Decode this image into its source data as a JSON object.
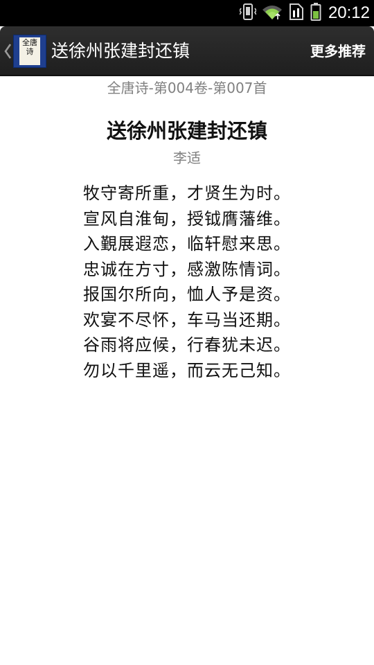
{
  "status_bar": {
    "time": "20:12",
    "icons": [
      "vibrate-icon",
      "wifi-icon",
      "sim-icon",
      "battery-icon"
    ]
  },
  "action_bar": {
    "logo_text": "全唐诗",
    "title": "送徐州张建封还镇",
    "more_label": "更多推荐"
  },
  "poem": {
    "source": "全唐诗-第004卷-第007首",
    "title": "送徐州张建封还镇",
    "author": "李适",
    "lines": [
      "牧守寄所重，才贤生为时。",
      "宣风自淮甸，授钺膺藩维。",
      "入覲展遐恋，临轩慰来思。",
      "忠诚在方寸，感激陈情词。",
      "报国尔所向，恤人予是资。",
      "欢宴不尽怀，车马当还期。",
      "谷雨将应候，行春犹未迟。",
      "勿以千里遥，而云无己知。"
    ]
  },
  "colors": {
    "status_bar_bg": "#000000",
    "action_bar_bg": "#262626",
    "logo_blue": "#1f3f8f",
    "battery_green": "#7dc142",
    "wifi_green": "#8fd14f",
    "secondary_text": "#808080",
    "primary_text": "#111111"
  }
}
